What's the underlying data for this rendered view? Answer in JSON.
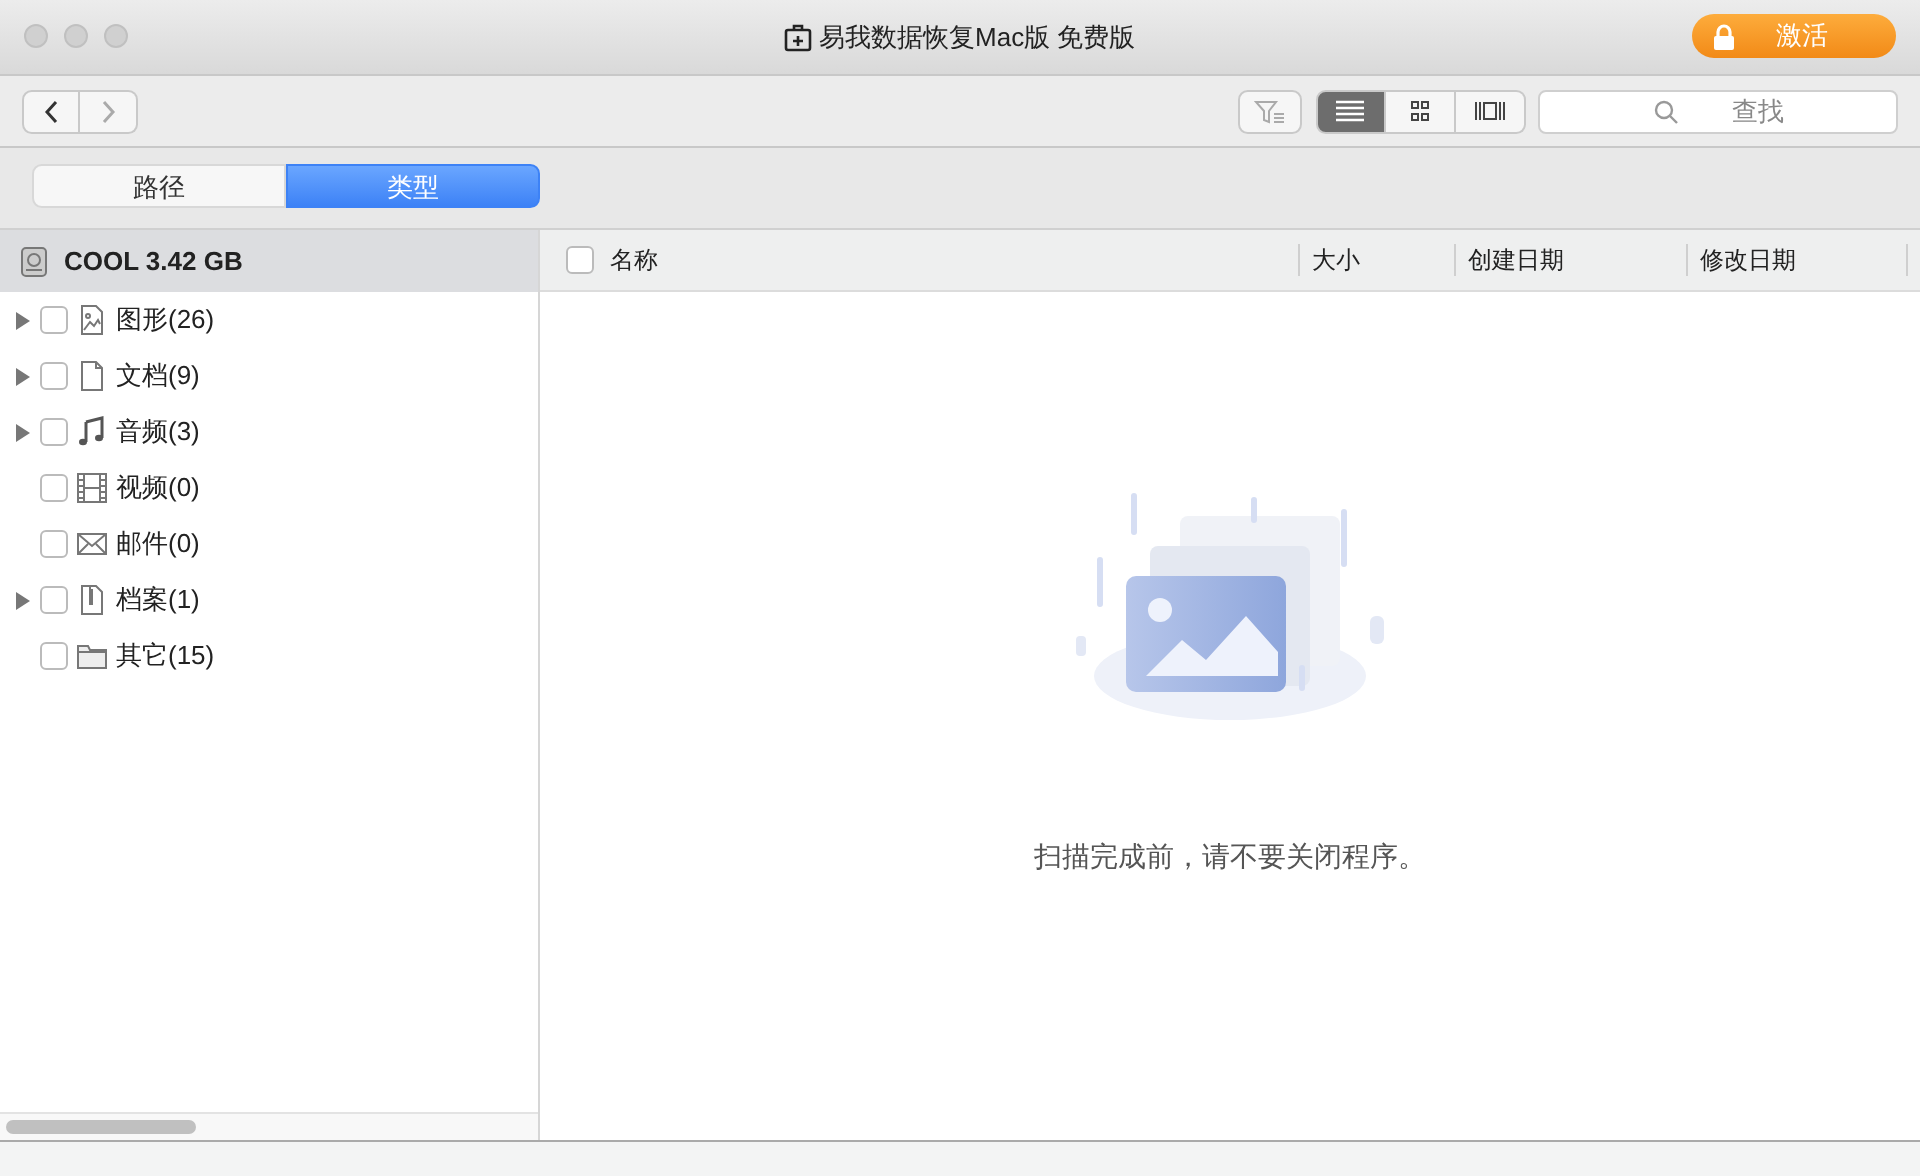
{
  "window": {
    "title": "易我数据恢复Mac版 免费版",
    "activate_button": "激活"
  },
  "toolbar": {
    "view_modes": [
      {
        "kind": "list",
        "selected": true
      },
      {
        "kind": "grid",
        "selected": false
      },
      {
        "kind": "cover",
        "selected": false
      }
    ],
    "search": {
      "placeholder": "查找"
    }
  },
  "segments": [
    {
      "label": "路径",
      "selected": false
    },
    {
      "label": "类型",
      "selected": true
    }
  ],
  "sidebar": {
    "drive": "COOL 3.42 GB",
    "items": [
      {
        "label": "图形(26)",
        "kind": "image",
        "expandable": true,
        "checked": false
      },
      {
        "label": "文档(9)",
        "kind": "document",
        "expandable": true,
        "checked": false
      },
      {
        "label": "音频(3)",
        "kind": "audio",
        "expandable": true,
        "checked": false
      },
      {
        "label": "视频(0)",
        "kind": "video",
        "expandable": false,
        "checked": false
      },
      {
        "label": "邮件(0)",
        "kind": "mail",
        "expandable": false,
        "checked": false
      },
      {
        "label": "档案(1)",
        "kind": "archive",
        "expandable": true,
        "checked": false
      },
      {
        "label": "其它(15)",
        "kind": "other",
        "expandable": false,
        "checked": false
      }
    ]
  },
  "table": {
    "select_all_checked": false,
    "columns": [
      "名称",
      "大小",
      "创建日期",
      "修改日期"
    ]
  },
  "empty_state": {
    "message": "扫描完成前，请不要关闭程序。"
  }
}
